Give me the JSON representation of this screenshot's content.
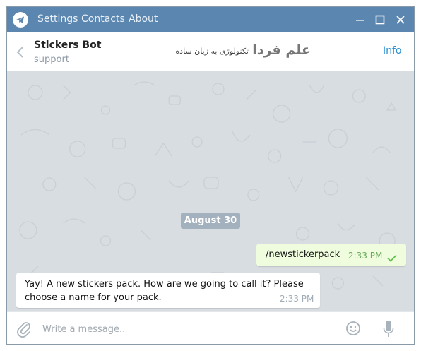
{
  "titlebar": {
    "menu": {
      "settings": "Settings",
      "contacts": "Contacts",
      "about": "About"
    },
    "icons": {
      "logo": "telegram-logo-icon",
      "minimize": "minimize-icon",
      "maximize": "maximize-icon",
      "close": "close-icon"
    }
  },
  "header": {
    "title": "Stickers Bot",
    "status": "support",
    "info": "Info",
    "watermark": {
      "brand": "علم فردا",
      "tagline": "تکنولوژی به زبان ساده"
    }
  },
  "conversation": {
    "date_badge": "August 30",
    "outgoing": {
      "text": "/newstickerpack",
      "time": "2:33 PM",
      "status_icon": "single-check-icon"
    },
    "incoming": {
      "text": "Yay! A new stickers pack. How are we going to call it? Please choose a name for your pack.",
      "time": "2:33 PM"
    }
  },
  "composer": {
    "placeholder": "Write a message..",
    "icons": {
      "attach": "paperclip-icon",
      "emoji": "emoji-icon",
      "voice": "microphone-icon"
    }
  },
  "colors": {
    "titlebar": "#5b86b0",
    "chat_background": "#d8dde2",
    "outgoing_bubble": "#effdde",
    "accent_link": "#2a8fd0",
    "check": "#5fbf4f"
  }
}
